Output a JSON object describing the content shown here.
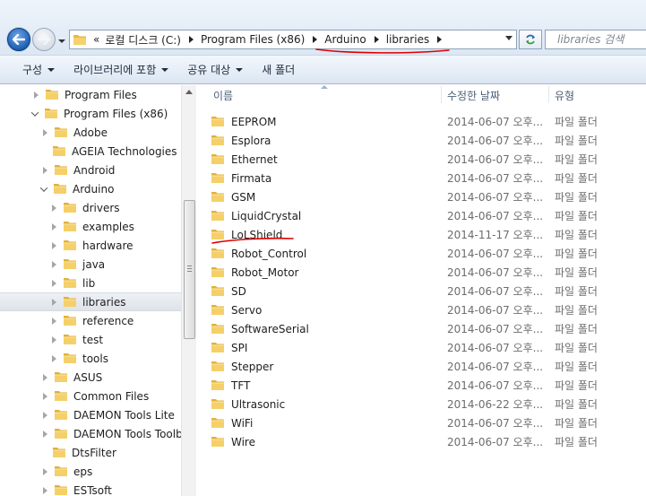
{
  "address": {
    "overflow": "«",
    "crumbs": [
      "로컬 디스크 (C:)",
      "Program Files (x86)",
      "Arduino",
      "libraries"
    ]
  },
  "search": {
    "placeholder": "libraries 검색"
  },
  "toolbar": {
    "organize": "구성",
    "include_in_library": "라이브러리에 포함",
    "share_with": "공유 대상",
    "new_folder": "새 폴더"
  },
  "nav": {
    "items": [
      {
        "label": "Program Files",
        "expanded": false
      },
      {
        "label": "Program Files (x86)",
        "expanded": true
      },
      {
        "label": "Adobe",
        "expanded": false
      },
      {
        "label": "AGEIA Technologies",
        "expanded": null
      },
      {
        "label": "Android",
        "expanded": false
      },
      {
        "label": "Arduino",
        "expanded": true
      },
      {
        "label": "drivers",
        "expanded": false
      },
      {
        "label": "examples",
        "expanded": false
      },
      {
        "label": "hardware",
        "expanded": false
      },
      {
        "label": "java",
        "expanded": false
      },
      {
        "label": "lib",
        "expanded": false
      },
      {
        "label": "libraries",
        "expanded": false,
        "selected": true
      },
      {
        "label": "reference",
        "expanded": false
      },
      {
        "label": "test",
        "expanded": false
      },
      {
        "label": "tools",
        "expanded": false
      },
      {
        "label": "ASUS",
        "expanded": false
      },
      {
        "label": "Common Files",
        "expanded": false
      },
      {
        "label": "DAEMON Tools Lite",
        "expanded": false
      },
      {
        "label": "DAEMON Tools Toolba",
        "expanded": false
      },
      {
        "label": "DtsFilter",
        "expanded": null
      },
      {
        "label": "eps",
        "expanded": false
      },
      {
        "label": "ESTsoft",
        "expanded": false
      }
    ]
  },
  "columns": {
    "name": "이름",
    "modified": "수정한 날짜",
    "type": "유형"
  },
  "files": [
    {
      "name": "EEPROM",
      "modified": "2014-06-07 오후...",
      "type": "파일 폴더"
    },
    {
      "name": "Esplora",
      "modified": "2014-06-07 오후...",
      "type": "파일 폴더"
    },
    {
      "name": "Ethernet",
      "modified": "2014-06-07 오후...",
      "type": "파일 폴더"
    },
    {
      "name": "Firmata",
      "modified": "2014-06-07 오후...",
      "type": "파일 폴더"
    },
    {
      "name": "GSM",
      "modified": "2014-06-07 오후...",
      "type": "파일 폴더"
    },
    {
      "name": "LiquidCrystal",
      "modified": "2014-06-07 오후...",
      "type": "파일 폴더"
    },
    {
      "name": "LoLShield",
      "modified": "2014-11-17 오후...",
      "type": "파일 폴더"
    },
    {
      "name": "Robot_Control",
      "modified": "2014-06-07 오후...",
      "type": "파일 폴더"
    },
    {
      "name": "Robot_Motor",
      "modified": "2014-06-07 오후...",
      "type": "파일 폴더"
    },
    {
      "name": "SD",
      "modified": "2014-06-07 오후...",
      "type": "파일 폴더"
    },
    {
      "name": "Servo",
      "modified": "2014-06-07 오후...",
      "type": "파일 폴더"
    },
    {
      "name": "SoftwareSerial",
      "modified": "2014-06-07 오후...",
      "type": "파일 폴더"
    },
    {
      "name": "SPI",
      "modified": "2014-06-07 오후...",
      "type": "파일 폴더"
    },
    {
      "name": "Stepper",
      "modified": "2014-06-07 오후...",
      "type": "파일 폴더"
    },
    {
      "name": "TFT",
      "modified": "2014-06-07 오후...",
      "type": "파일 폴더"
    },
    {
      "name": "Ultrasonic",
      "modified": "2014-06-22 오후...",
      "type": "파일 폴더"
    },
    {
      "name": "WiFi",
      "modified": "2014-06-07 오후...",
      "type": "파일 폴더"
    },
    {
      "name": "Wire",
      "modified": "2014-06-07 오후...",
      "type": "파일 폴더"
    }
  ],
  "colors": {
    "annotation": "#e00000",
    "folder": "#f0c850",
    "selection": "#e2e6eb"
  }
}
